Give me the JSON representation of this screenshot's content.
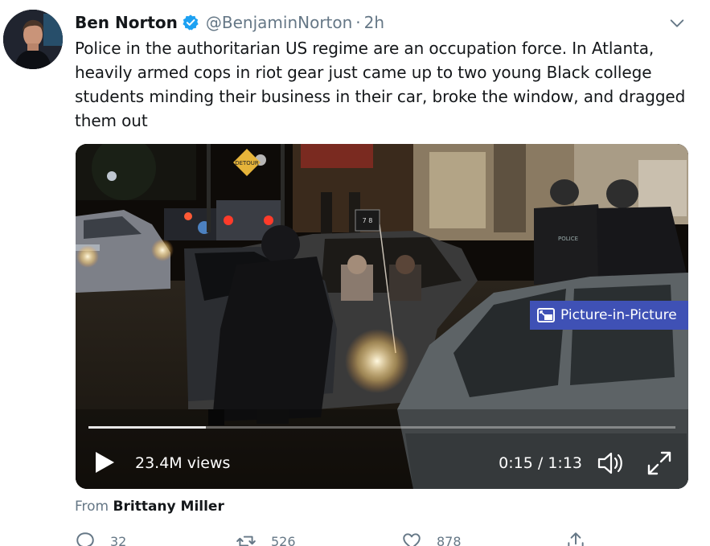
{
  "author": {
    "name": "Ben Norton",
    "handle": "@BenjaminNorton",
    "separator": "·",
    "time": "2h",
    "verified": true,
    "avatar_icon": "profile-photo"
  },
  "tweet": {
    "text": "Police in the authoritarian US regime are an occupation force. In Atlanta, heavily armed cops in riot gear just came up to two young Black college students minding their business in their car, broke the window, and dragged them out"
  },
  "video": {
    "pip_label": "Picture-in-Picture",
    "views": "23.4M views",
    "current_time": "0:15",
    "time_separator": " / ",
    "duration": "1:13",
    "progress_fraction": 0.2,
    "scene_signs": {
      "street_sign": "DETOUR",
      "plate": "7 8"
    }
  },
  "attribution": {
    "prefix": "From",
    "source": "Brittany Miller"
  },
  "actions": {
    "reply_count": "32",
    "retweet_count": "526",
    "like_count": "878"
  },
  "colors": {
    "text": "#14171a",
    "muted": "#657786",
    "verified": "#1da1f2",
    "pip": "#3f51b5"
  }
}
